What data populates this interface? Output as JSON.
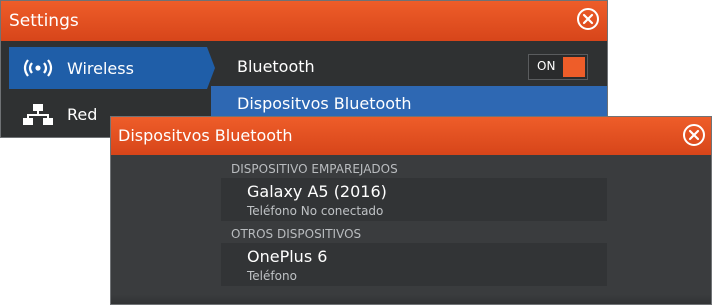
{
  "settings": {
    "title": "Settings",
    "sidebar": [
      {
        "label": "Wireless",
        "icon": "wireless-icon",
        "active": true
      },
      {
        "label": "Red",
        "icon": "network-icon",
        "active": false
      }
    ],
    "rows": [
      {
        "label": "Bluetooth",
        "toggle": "ON"
      },
      {
        "label": "Dispositvos Bluetooth",
        "selected": true
      }
    ]
  },
  "dialog": {
    "title": "Dispositvos Bluetooth",
    "sections": [
      {
        "heading": "DISPOSITIVO EMPAREJADOS",
        "devices": [
          {
            "name": "Galaxy A5 (2016)",
            "status": "Teléfono No conectado"
          }
        ]
      },
      {
        "heading": "OTROS DISPOSITIVOS",
        "devices": [
          {
            "name": "OnePlus 6",
            "status": "Teléfono"
          }
        ]
      }
    ]
  },
  "colors": {
    "accent": "#ee5d29",
    "selection": "#2e68b3",
    "background": "#2f3132"
  }
}
